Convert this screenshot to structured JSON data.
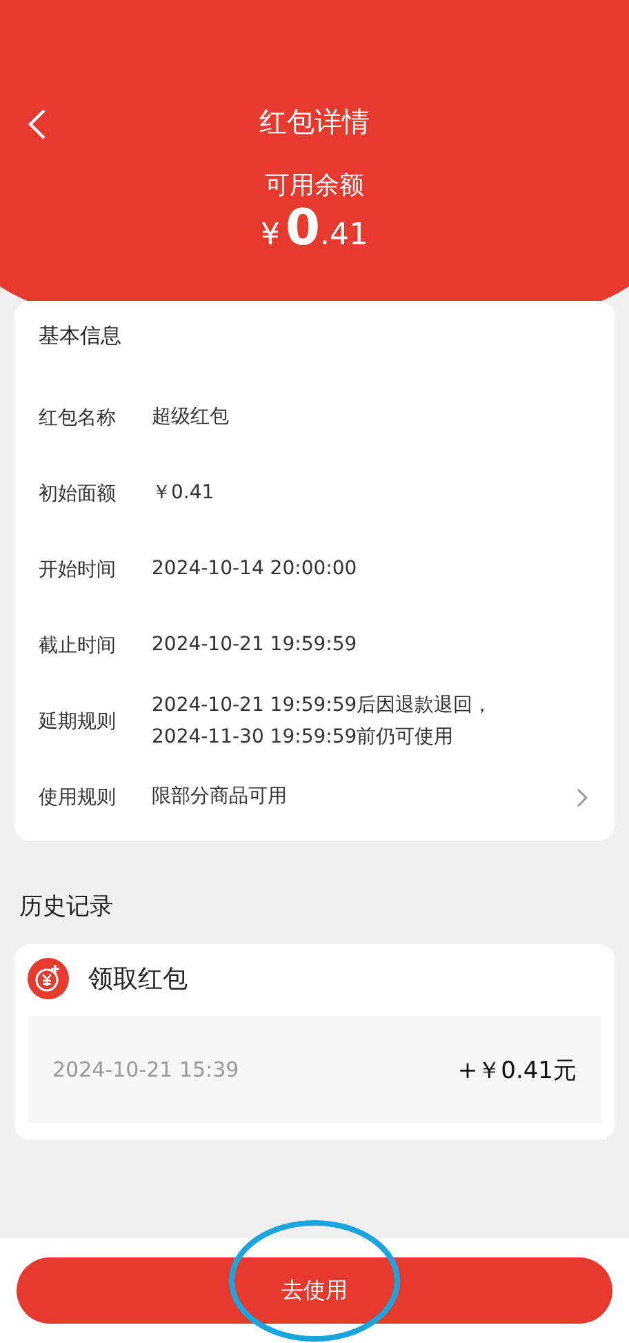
{
  "header": {
    "title": "红包详情",
    "balance_label": "可用余额",
    "balance": {
      "currency": "¥",
      "integer": "0",
      "decimal": ".41"
    }
  },
  "info": {
    "title": "基本信息",
    "rows": [
      {
        "kind": "text",
        "label": "红包名称",
        "value": "超级红包"
      },
      {
        "kind": "text",
        "label": "初始面额",
        "value": "￥0.41"
      },
      {
        "kind": "text",
        "label": "开始时间",
        "value": "2024-10-14 20:00:00"
      },
      {
        "kind": "text",
        "label": "截止时间",
        "value": "2024-10-21 19:59:59"
      },
      {
        "kind": "text",
        "label": "延期规则",
        "value": "2024-10-21 19:59:59后因退款退回，\n2024-11-30 19:59:59前仍可使用"
      },
      {
        "kind": "link",
        "label": "使用规则",
        "value": "限部分商品可用"
      }
    ]
  },
  "history": {
    "title": "历史记录",
    "entries": [
      {
        "title": "领取红包",
        "time": "2024-10-21 15:39",
        "amount": "+￥0.41元"
      }
    ]
  },
  "action": {
    "label": "去使用",
    "highlighted": true
  }
}
